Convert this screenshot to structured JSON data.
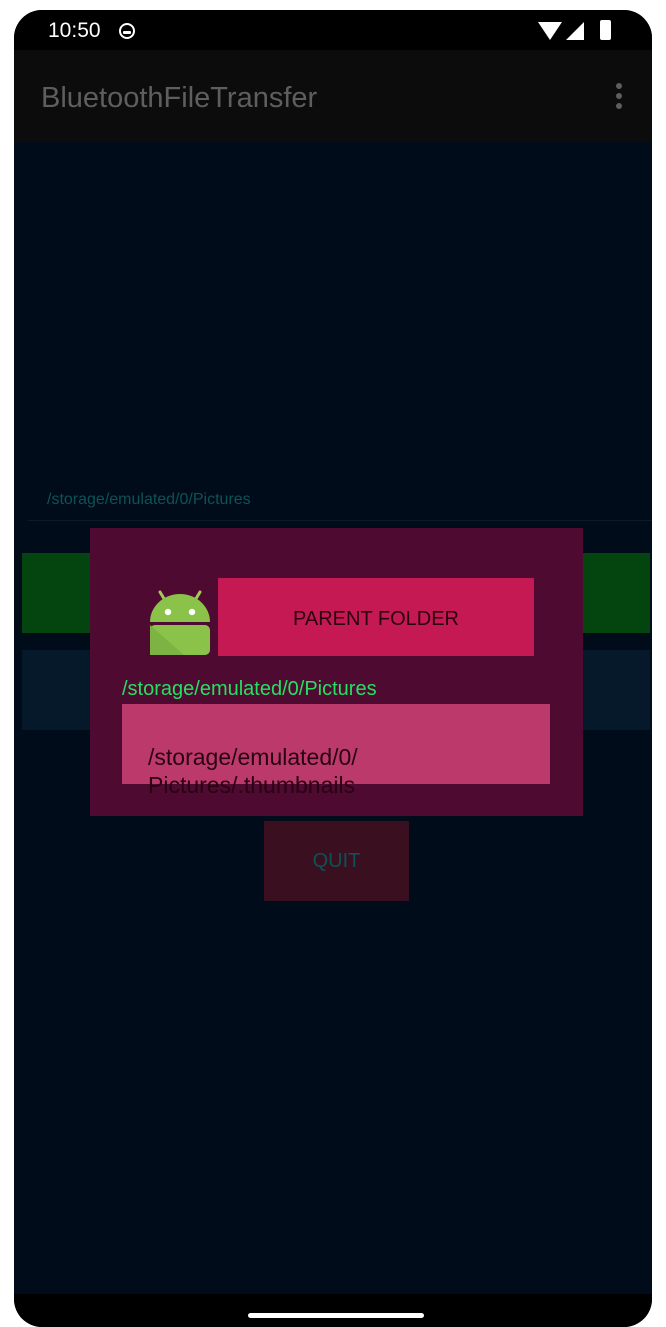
{
  "status_bar": {
    "time": "10:50",
    "icons": [
      "notification-icon",
      "wifi-icon",
      "cellular-icon",
      "battery-icon"
    ]
  },
  "toolbar": {
    "title": "BluetoothFileTransfer",
    "overflow_icon": "overflow-menu-icon"
  },
  "background": {
    "current_path": "/storage/emulated/0/Pictures",
    "quit_label": "QUIT"
  },
  "dialog": {
    "icon": "android-icon",
    "parent_button_label": "PARENT FOLDER",
    "current_path": "/storage/emulated/0/Pictures",
    "items": [
      {
        "label": "/storage/emulated/0/\nPictures/.thumbnails"
      }
    ]
  },
  "colors": {
    "screen_bg": "#000c1a",
    "toolbar_bg": "#0c0c0c",
    "dialog_bg": "#4e0a30",
    "parent_button": "#c41952",
    "list_item": "#bb3a6b",
    "path_text": "#25e061"
  }
}
